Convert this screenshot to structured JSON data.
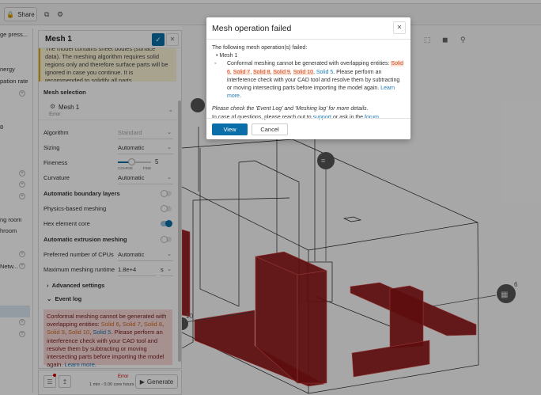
{
  "toolbar": {
    "share_label": "Share"
  },
  "tree": {
    "items": [
      "ge press...",
      "nergy",
      "pation rate",
      "8",
      "ng room",
      "hroom",
      "Netw..."
    ]
  },
  "panel": {
    "title": "Mesh 1",
    "warning": "The model contains sheet bodies (surface data). The meshing algorithm requires solid regions only and therefore surface parts will be ignored in case you continue. It is recommended to solidify all parts.",
    "mesh_selection_label": "Mesh selection",
    "mesh_name": "Mesh 1",
    "mesh_status": "Error",
    "algorithm_label": "Algorithm",
    "algorithm_value": "Standard",
    "sizing_label": "Sizing",
    "sizing_value": "Automatic",
    "fineness_label": "Fineness",
    "fineness_value": "5",
    "fineness_fraction": 0.4,
    "coarse": "COARSE",
    "fine": "FINE",
    "curvature_label": "Curvature",
    "curvature_value": "Automatic",
    "abl_label": "Automatic boundary layers",
    "abl_on": false,
    "physics_label": "Physics-based meshing",
    "physics_on": false,
    "hex_label": "Hex element core",
    "hex_on": true,
    "extrusion_label": "Automatic extrusion meshing",
    "extrusion_on": false,
    "cpus_label": "Preferred number of CPUs",
    "cpus_value": "Automatic",
    "runtime_label": "Maximum meshing runtime",
    "runtime_value": "1.8e+4",
    "runtime_unit": "s",
    "advanced_label": "Advanced settings",
    "eventlog_label": "Event log",
    "eventlog": {
      "pre": "Conformal meshing cannot be generated with overlapping entities: ",
      "s6": "Solid 6",
      "s7": "Solid 7",
      "s8": "Solid 8",
      "s9": "Solid 9",
      "s10": "Solid 10",
      "s5": "Solid 5",
      "post": ". Please perform an interference check with your CAD tool and resolve them by subtracting or moving intersecting parts before importing the model again. ",
      "learn": "Learn more",
      "dot": "."
    },
    "footer_status": "Error",
    "footer_estimate": "1 min - 0.00 core hours",
    "generate_label": "Generate"
  },
  "viewer": {
    "label_10": "10",
    "label_6": "6"
  },
  "modal": {
    "title": "Mesh operation failed",
    "intro": "The following mesh operation(s) failed:",
    "item": "Mesh 1",
    "pre": "Conformal meshing cannot be generated with overlapping entities: ",
    "s6": "Solid 6",
    "s7": "Solid 7",
    "s8": "Solid 8",
    "s9": "Solid 9",
    "s10": "Solid 10",
    "s5": "Solid 5",
    "post": ". Please perform an interference check with your CAD tool and resolve them by subtracting or moving intersecting parts before importing the model again. ",
    "learn": "Learn more",
    "check": "Please check the 'Event Log' and 'Meshing log' for more details.",
    "questions_pre": "In case of questions, please reach out to ",
    "support": "support",
    "questions_mid": " or ask in the ",
    "forum": "forum",
    "view_label": "View",
    "cancel_label": "Cancel"
  }
}
